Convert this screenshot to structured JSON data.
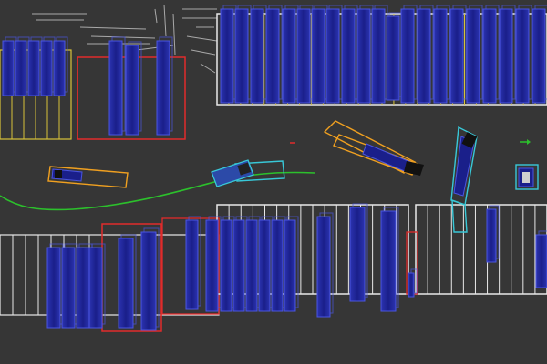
{
  "view": {
    "background": "#363636",
    "colors": {
      "slot_line": "#e8e8e8",
      "slot_line_yellow": "#d8c23a",
      "vehicle_fill": "#1a1f8a",
      "vehicle_edge": "#4a55e0",
      "red_region": "#e02b2b",
      "orange_box": "#f0a020",
      "cyan_box": "#38c8d8",
      "trajectory": "#2cc02c",
      "map_points": "#bdbdbd"
    },
    "icons": [
      "ego-vehicle-icon",
      "arrow-marker-icon"
    ]
  }
}
